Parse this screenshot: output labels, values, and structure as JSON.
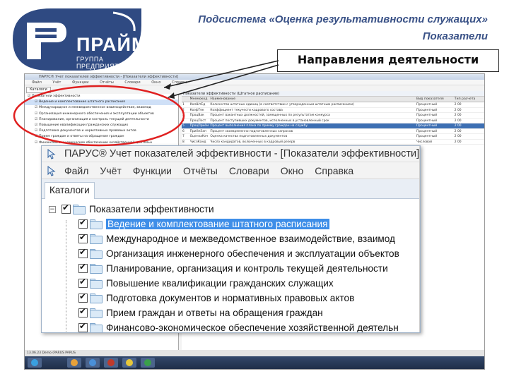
{
  "header": {
    "logo_name": "ПРАЙМ",
    "logo_sub": "ГРУППА ПРЕДПРИЯТИЙ",
    "title_line1": "Подсистема «Оценка результативности служащих»",
    "title_line2": "Показатели",
    "callout": "Направления деятельности",
    "brand_color": "#2f4a82",
    "title_color": "#3a5287"
  },
  "window": {
    "title": "ПАРУС® Учет показателей эффективности - [Показатели эффективности]",
    "menu": [
      "Файл",
      "Учёт",
      "Функции",
      "Отчёты",
      "Словари",
      "Окно",
      "Справка"
    ],
    "tab": "Каталоги",
    "tree": {
      "root": "Показатели эффективности",
      "items": [
        "Ведение и комплектование штатного расписания",
        "Международное и межведомственное взаимодействие, взаимод",
        "Организация инженерного обеспечения и эксплуатации объектов",
        "Планирование, организация и контроль текущей деятельности",
        "Повышение квалификации гражданских служащих",
        "Подготовка документов и нормативных правовых актов",
        "Прием граждан и ответы на обращения граждан",
        "Финансово-экономическое обеспечение хозяйственной деятельн"
      ],
      "selected_index": 0
    }
  },
  "background_app": {
    "grid_title": "Показатели эффективности (Штатное расписание)",
    "column_headers": [
      "",
      "Мнемокод",
      "Наименование",
      "Вид показателя",
      "Тип расчета"
    ],
    "rows": [
      [
        "1",
        "КолШтЕд",
        "Количество штатных единиц (в соответствии с утвержденным штатным расписанием)",
        "Процентный",
        "2 00"
      ],
      [
        "2",
        "КоэфТек",
        "Коэффициент текучести кадрового состава",
        "Процентный",
        "2 00"
      ],
      [
        "3",
        "ПроцВак",
        "Процент вакантных должностей, замещенных по результатам конкурса",
        "Процентный",
        "2 00"
      ],
      [
        "4",
        "ПроцПост",
        "Процент поступивших документов, исполненных в установленный срок",
        "Процентный",
        "2 00"
      ],
      [
        "5",
        "ПроцПриём",
        "Процент выполнения плана по приему граждан на службу",
        "Процентный",
        "2 00"
      ],
      [
        "6",
        "ПриёмЗап",
        "Процент своевременно подготовленных запросов",
        "Процентный",
        "2 00"
      ],
      [
        "7",
        "ОценкаКач",
        "Оценка качества подготовленных документов",
        "Процентный",
        "2 00"
      ],
      [
        "8",
        "ЧислКанд",
        "Число кандидатов, включенных в кадровый резерв",
        "Числовой",
        "2 00"
      ]
    ],
    "status_text": "13.06.23    Demo (PARUS    PARUS",
    "menu": [
      "ПАРУС® Учет показателей эффективности",
      "Показатели эффективности"
    ]
  }
}
